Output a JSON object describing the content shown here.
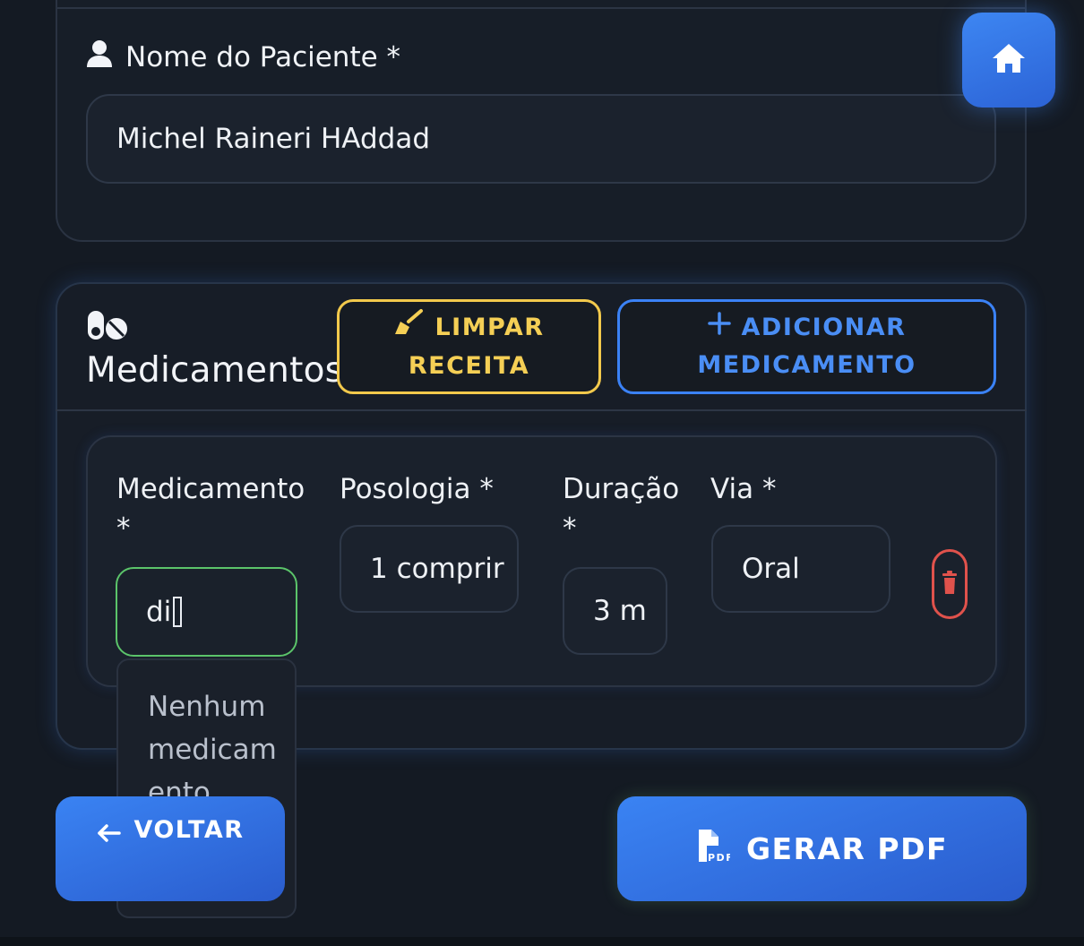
{
  "patient": {
    "label": "Nome do Paciente *",
    "value": "Michel Raineri HAddad"
  },
  "home": {
    "icon": "home-icon"
  },
  "medications": {
    "title": "Medicamentos",
    "clear_label_line1": "LIMPAR",
    "clear_label_line2": "RECEITA",
    "add_label_line1": "ADICIONAR",
    "add_label_line2": "MEDICAMENTO",
    "columns": {
      "medicamento": "Medicamento",
      "medicamento_req": "*",
      "posologia": "Posologia *",
      "duracao": "Duração",
      "duracao_req": "*",
      "via": "Via *"
    },
    "row": {
      "medicamento_value": "di",
      "posologia_value": "1 comprir",
      "duracao_value": "3 m",
      "via_value": "Oral"
    },
    "suggestions": {
      "line1": "Nenhum",
      "line2": "medicam",
      "line3": "ento"
    }
  },
  "actions": {
    "back_label": "VOLTAR",
    "pdf_label": "GERAR PDF"
  },
  "colors": {
    "background": "#141a23",
    "accent_blue": "#3b82f6",
    "accent_yellow": "#f2c94c",
    "danger_red": "#e0524c",
    "active_green": "#5bc46a"
  }
}
